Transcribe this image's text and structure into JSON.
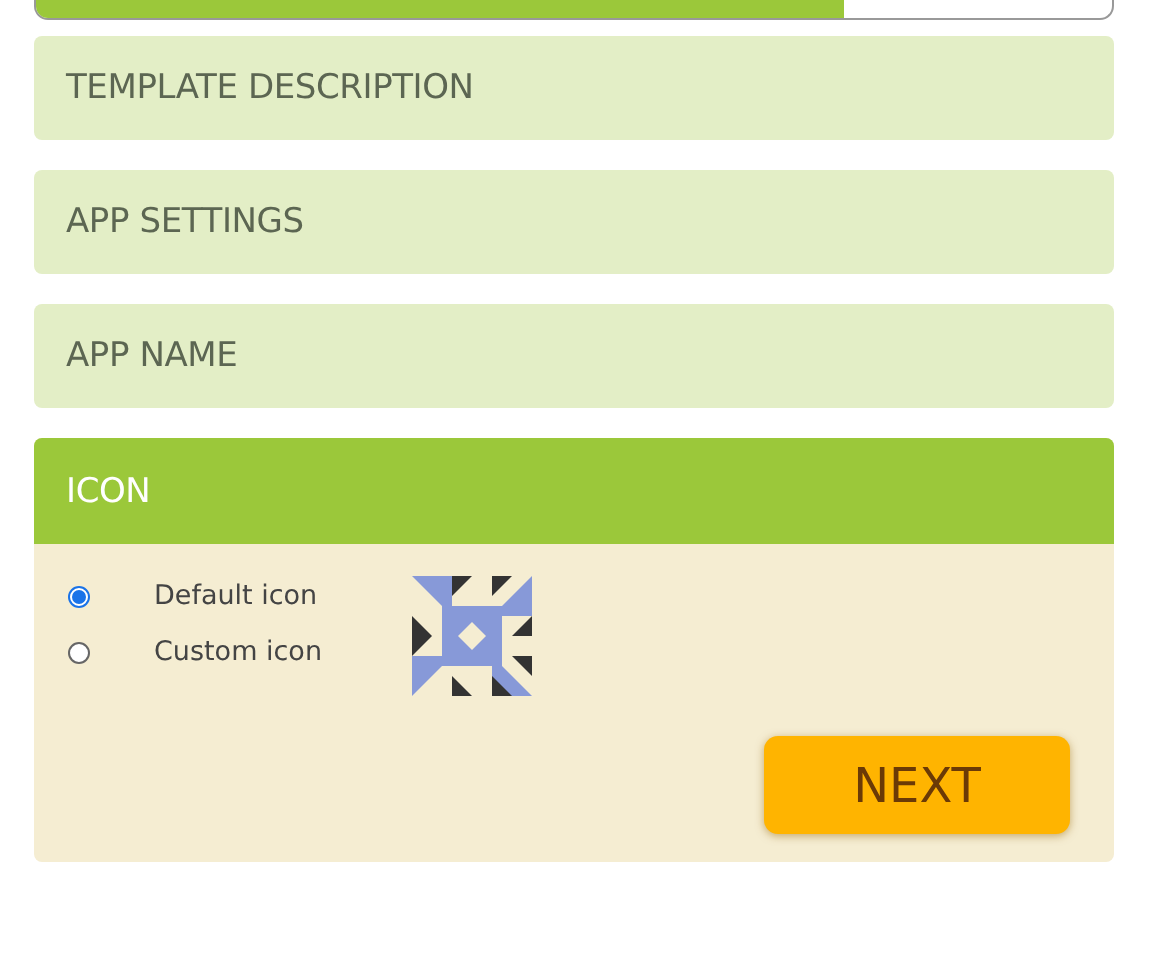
{
  "progress": {
    "level": 0.75
  },
  "sections": [
    {
      "title": "TEMPLATE DESCRIPTION",
      "expanded": false
    },
    {
      "title": "APP SETTINGS",
      "expanded": false
    },
    {
      "title": "APP NAME",
      "expanded": false
    },
    {
      "title": "ICON",
      "expanded": true,
      "options": [
        {
          "label": "Default icon",
          "selected": true
        },
        {
          "label": "Custom icon",
          "selected": false
        }
      ],
      "button": "NEXT"
    }
  ]
}
